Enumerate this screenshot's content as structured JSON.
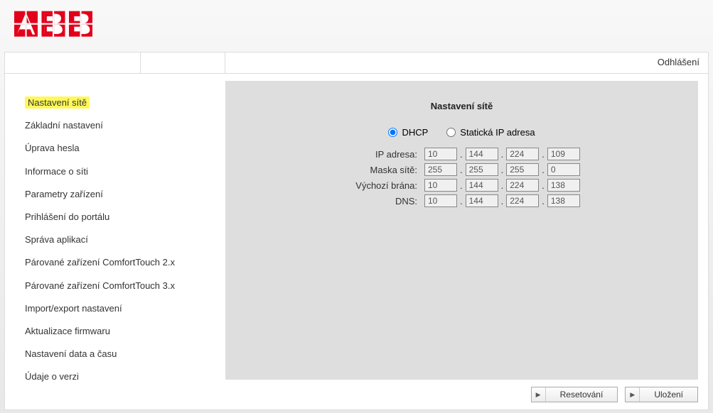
{
  "header": {
    "logout": "Odhlášení"
  },
  "sidebar": {
    "items": [
      {
        "label": "Nastavení sítě",
        "active": true
      },
      {
        "label": "Základní nastavení",
        "active": false
      },
      {
        "label": "Úprava hesla",
        "active": false
      },
      {
        "label": "Informace o síti",
        "active": false
      },
      {
        "label": "Parametry zařízení",
        "active": false
      },
      {
        "label": "Prihlášení do portálu",
        "active": false
      },
      {
        "label": "Správa aplikací",
        "active": false
      },
      {
        "label": "Párované zařízení ComfortTouch 2.x",
        "active": false
      },
      {
        "label": "Párované zařízení ComfortTouch 3.x",
        "active": false
      },
      {
        "label": "Import/export nastavení",
        "active": false
      },
      {
        "label": "Aktualizace firmwaru",
        "active": false
      },
      {
        "label": "Nastavení data a času",
        "active": false
      },
      {
        "label": "Údaje o verzi",
        "active": false
      }
    ]
  },
  "panel": {
    "title": "Nastavení sítě",
    "mode": {
      "dhcp_label": "DHCP",
      "static_label": "Statická IP adresa",
      "selected": "dhcp"
    },
    "fields": {
      "ip": {
        "label": "IP adresa:",
        "octets": [
          "10",
          "144",
          "224",
          "109"
        ]
      },
      "mask": {
        "label": "Maska sítě:",
        "octets": [
          "255",
          "255",
          "255",
          "0"
        ]
      },
      "gateway": {
        "label": "Výchozí brána:",
        "octets": [
          "10",
          "144",
          "224",
          "138"
        ]
      },
      "dns": {
        "label": "DNS:",
        "octets": [
          "10",
          "144",
          "224",
          "138"
        ]
      }
    }
  },
  "buttons": {
    "reset": "Resetování",
    "save": "Uložení"
  }
}
